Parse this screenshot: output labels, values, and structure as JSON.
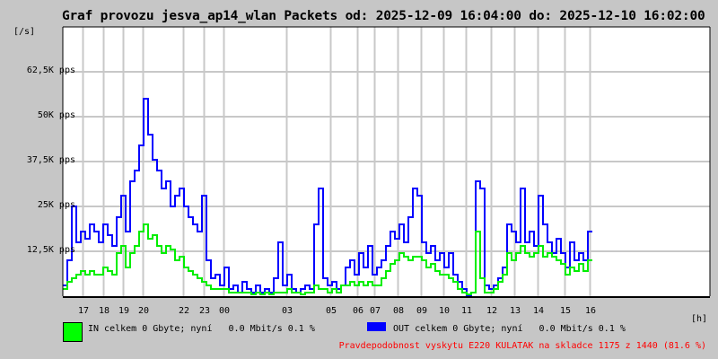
{
  "chart_data": {
    "type": "line",
    "title": "Graf provozu jesva_ap14_wlan Packets od: 2025-12-09 16:04:00 do: 2025-12-10 16:02:00",
    "ylabel": "[/s]",
    "xlabel": "[h]",
    "ylim": [
      0,
      75
    ],
    "xlim": [
      0,
      144.2
    ],
    "y_ticks": [
      {
        "value": 12.5,
        "label": "12,5K pps"
      },
      {
        "value": 25,
        "label": "25K pps"
      },
      {
        "value": 37.5,
        "label": "37,5K pps"
      },
      {
        "value": 50,
        "label": "50K pps"
      },
      {
        "value": 62.5,
        "label": "62,5K pps"
      }
    ],
    "x_ticks": [
      {
        "value": 4.4,
        "label": "17"
      },
      {
        "value": 9,
        "label": "18"
      },
      {
        "value": 13.4,
        "label": "19"
      },
      {
        "value": 17.8,
        "label": "20"
      },
      {
        "value": 26.8,
        "label": "22"
      },
      {
        "value": 31.4,
        "label": "23"
      },
      {
        "value": 35.8,
        "label": "00"
      },
      {
        "value": 49.8,
        "label": "03"
      },
      {
        "value": 59.6,
        "label": "05"
      },
      {
        "value": 65.6,
        "label": "06"
      },
      {
        "value": 69.4,
        "label": "07"
      },
      {
        "value": 74.6,
        "label": "08"
      },
      {
        "value": 79.8,
        "label": "09"
      },
      {
        "value": 84.8,
        "label": "10"
      },
      {
        "value": 89.8,
        "label": "11"
      },
      {
        "value": 95.4,
        "label": "12"
      },
      {
        "value": 100.6,
        "label": "13"
      },
      {
        "value": 105.8,
        "label": "14"
      },
      {
        "value": 111.8,
        "label": "15"
      },
      {
        "value": 117.4,
        "label": "16"
      }
    ],
    "grid": true,
    "series": [
      {
        "name": "OUT",
        "color": "#0000ff",
        "values": [
          3,
          10,
          25,
          15,
          18,
          16,
          20,
          18,
          15,
          20,
          17,
          14,
          22,
          28,
          18,
          32,
          35,
          42,
          55,
          45,
          38,
          35,
          30,
          32,
          25,
          28,
          30,
          25,
          22,
          20,
          18,
          28,
          10,
          5,
          6,
          3,
          8,
          2,
          3,
          1,
          4,
          2,
          1,
          3,
          1,
          2,
          1,
          5,
          15,
          3,
          6,
          2,
          1,
          2,
          3,
          2,
          20,
          30,
          5,
          3,
          4,
          2,
          3,
          8,
          10,
          6,
          12,
          8,
          14,
          6,
          8,
          10,
          14,
          18,
          16,
          20,
          15,
          22,
          30,
          28,
          15,
          12,
          14,
          10,
          12,
          8,
          12,
          6,
          4,
          2,
          0,
          1,
          32,
          30,
          3,
          2,
          3,
          5,
          8,
          20,
          18,
          15,
          30,
          15,
          18,
          14,
          28,
          20,
          15,
          12,
          16,
          12,
          8,
          15,
          10,
          12,
          10,
          18
        ]
      },
      {
        "name": "IN",
        "color": "#00ee00",
        "values": [
          2,
          4,
          5,
          6,
          7,
          6,
          7,
          6,
          6,
          8,
          7,
          6,
          12,
          14,
          8,
          12,
          14,
          18,
          20,
          16,
          17,
          14,
          12,
          14,
          13,
          10,
          11,
          8,
          7,
          6,
          5,
          4,
          3,
          2,
          2,
          2,
          2,
          1,
          1,
          1,
          1,
          1,
          0.5,
          1,
          0.5,
          1,
          0.5,
          1,
          1,
          1,
          2,
          1,
          1,
          0.5,
          1,
          1,
          3,
          2,
          2,
          1,
          2,
          1,
          3,
          3,
          4,
          3,
          4,
          3,
          4,
          3,
          3,
          5,
          7,
          9,
          10,
          12,
          11,
          10,
          11,
          11,
          10,
          8,
          9,
          7,
          6,
          6,
          5,
          4,
          2,
          1,
          0.5,
          1,
          18,
          5,
          1,
          1,
          2,
          4,
          6,
          12,
          10,
          12,
          14,
          12,
          11,
          12,
          14,
          11,
          12,
          11,
          10,
          9,
          6,
          8,
          7,
          9,
          7,
          10
        ]
      }
    ]
  },
  "legend": {
    "in_label": "IN celkem 0 Gbyte; nyní   0.0 Mbit/s 0.1 %",
    "out_label": "OUT celkem 0 Gbyte; nyní   0.0 Mbit/s 0.1 %",
    "in_color": "#00ff00",
    "out_color": "#0000ff"
  },
  "note": "Pravdepodobnost vyskytu E220 KULATAK na skladce 1175 z 1440 (81.6 %)"
}
